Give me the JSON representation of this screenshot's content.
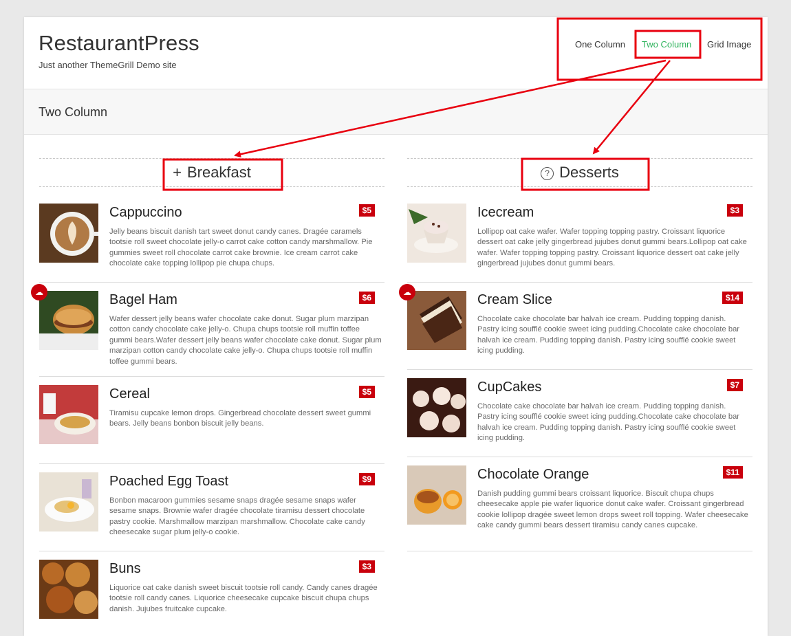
{
  "site": {
    "title": "RestaurantPress",
    "tagline": "Just another ThemeGrill Demo site"
  },
  "nav": [
    {
      "label": "One Column"
    },
    {
      "label": "Two Column"
    },
    {
      "label": "Grid Image"
    }
  ],
  "page_title": "Two Column",
  "categories": [
    {
      "label": "Breakfast",
      "icon": "plus-icon"
    },
    {
      "label": "Desserts",
      "icon": "question-circle-icon"
    }
  ],
  "colors": {
    "accent": "#c9000c",
    "nav_active": "#2eb35c",
    "annotation": "#e8000f"
  },
  "breakfast": [
    {
      "name": "Cappuccino",
      "price": "$5",
      "desc": "Jelly beans biscuit danish tart sweet donut candy canes. Dragée caramels tootsie roll sweet chocolate jelly-o carrot cake cotton candy marshmallow. Pie gummies sweet roll chocolate carrot cake brownie. Ice cream carrot cake chocolate cake topping lollipop pie chupa chups."
    },
    {
      "name": "Bagel Ham",
      "price": "$6",
      "desc": "Wafer dessert jelly beans wafer chocolate cake donut. Sugar plum marzipan cotton candy chocolate cake jelly-o. Chupa chups tootsie roll muffin toffee gummi bears.Wafer dessert jelly beans wafer chocolate cake donut. Sugar plum marzipan cotton candy chocolate cake jelly-o. Chupa chups tootsie roll muffin toffee gummi bears."
    },
    {
      "name": "Cereal",
      "price": "$5",
      "desc": "Tiramisu cupcake lemon drops. Gingerbread chocolate dessert sweet gummi bears. Jelly beans bonbon biscuit jelly beans."
    },
    {
      "name": "Poached Egg Toast",
      "price": "$9",
      "desc": "Bonbon macaroon gummies sesame snaps dragée sesame snaps wafer sesame snaps. Brownie wafer dragée chocolate tiramisu dessert chocolate pastry cookie. Marshmallow marzipan marshmallow. Chocolate cake candy cheesecake sugar plum jelly-o cookie."
    },
    {
      "name": "Buns",
      "price": "$3",
      "desc": "Liquorice oat cake danish sweet biscuit tootsie roll candy. Candy canes dragée tootsie roll candy canes. Liquorice cheesecake cupcake biscuit chupa chups danish. Jujubes fruitcake cupcake."
    }
  ],
  "desserts": [
    {
      "name": "Icecream",
      "price": "$3",
      "desc": "Lollipop oat cake wafer. Wafer topping topping pastry. Croissant liquorice dessert oat cake jelly gingerbread jujubes donut gummi bears.Lollipop oat cake wafer. Wafer topping topping pastry. Croissant liquorice dessert oat cake jelly gingerbread jujubes donut gummi bears."
    },
    {
      "name": "Cream Slice",
      "price": "$14",
      "desc": "Chocolate cake chocolate bar halvah ice cream. Pudding topping danish. Pastry icing soufflé cookie sweet icing pudding.Chocolate cake chocolate bar halvah ice cream. Pudding topping danish. Pastry icing soufflé cookie sweet icing pudding."
    },
    {
      "name": "CupCakes",
      "price": "$7",
      "desc": "Chocolate cake chocolate bar halvah ice cream. Pudding topping danish. Pastry icing soufflé cookie sweet icing pudding.Chocolate cake chocolate bar halvah ice cream. Pudding topping danish. Pastry icing soufflé cookie sweet icing pudding."
    },
    {
      "name": "Chocolate Orange",
      "price": "$11",
      "desc": "Danish pudding gummi bears croissant liquorice. Biscuit chupa chups cheesecake apple pie wafer liquorice donut cake wafer. Croissant gingerbread cookie lollipop dragée sweet lemon drops sweet roll topping. Wafer cheesecake cake candy gummi bears dessert tiramisu candy canes cupcake."
    }
  ]
}
